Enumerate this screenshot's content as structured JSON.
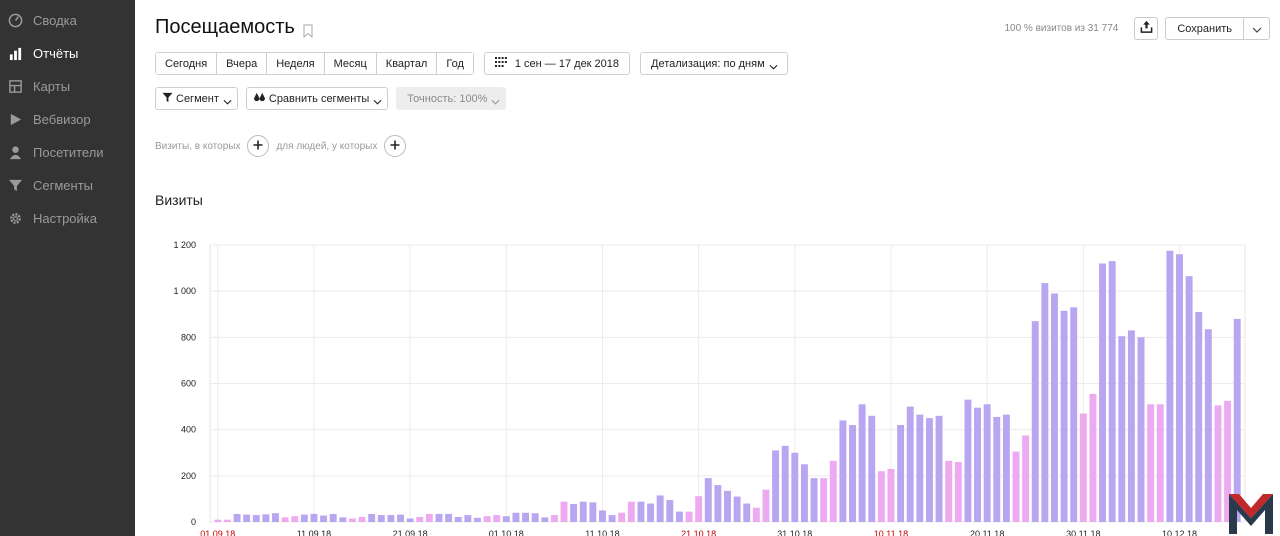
{
  "sidebar": {
    "items": [
      {
        "label": "Сводка",
        "icon": "dashboard-icon",
        "active": false
      },
      {
        "label": "Отчёты",
        "icon": "bar-chart-icon",
        "active": true
      },
      {
        "label": "Карты",
        "icon": "map-icon",
        "active": false
      },
      {
        "label": "Вебвизор",
        "icon": "play-icon",
        "active": false
      },
      {
        "label": "Посетители",
        "icon": "person-icon",
        "active": false
      },
      {
        "label": "Сегменты",
        "icon": "funnel-icon",
        "active": false
      },
      {
        "label": "Настройка",
        "icon": "gear-icon",
        "active": false
      }
    ]
  },
  "header": {
    "title": "Посещаемость",
    "visits_share": "100 % визитов из 31 774",
    "save_label": "Сохранить"
  },
  "periods": [
    "Сегодня",
    "Вчера",
    "Неделя",
    "Месяц",
    "Квартал",
    "Год"
  ],
  "date_range": "1 сен — 17 дек 2018",
  "detail": "Детализация: по дням",
  "segment_label": "Сегмент",
  "compare_label": "Сравнить сегменты",
  "accuracy_label": "Точность: 100%",
  "filter": {
    "visits_text": "Визиты, в которых",
    "people_text": "для людей, у которых"
  },
  "section_title": "Визиты",
  "colors": {
    "workday": "#b9a6f0",
    "weekend": "#eeaaf0",
    "sidebar": "#333333",
    "holiday_label": "#cc0000"
  },
  "chart_data": {
    "type": "bar",
    "ylim": [
      0,
      1200
    ],
    "yticks": [
      "1 200",
      "1 000",
      "800",
      "600",
      "400",
      "200",
      "0"
    ],
    "xticks": [
      {
        "label": "01.09.18",
        "holiday": true
      },
      {
        "label": "11.09.18",
        "holiday": false
      },
      {
        "label": "21.09.18",
        "holiday": false
      },
      {
        "label": "01.10.18",
        "holiday": false
      },
      {
        "label": "11.10.18",
        "holiday": false
      },
      {
        "label": "21.10.18",
        "holiday": true
      },
      {
        "label": "31.10.18",
        "holiday": false
      },
      {
        "label": "10.11.18",
        "holiday": true
      },
      {
        "label": "20.11.18",
        "holiday": false
      },
      {
        "label": "30.11.18",
        "holiday": false
      },
      {
        "label": "10.12.18",
        "holiday": false
      }
    ],
    "values": [
      10,
      10,
      35,
      32,
      30,
      33,
      38,
      20,
      25,
      32,
      35,
      28,
      35,
      20,
      15,
      22,
      35,
      30,
      30,
      32,
      15,
      22,
      35,
      35,
      35,
      22,
      30,
      18,
      25,
      30,
      25,
      40,
      40,
      38,
      20,
      30,
      88,
      78,
      88,
      85,
      50,
      30,
      40,
      88,
      88,
      80,
      115,
      95,
      45,
      45,
      112,
      190,
      160,
      135,
      110,
      80,
      62,
      140,
      310,
      330,
      300,
      250,
      190,
      190,
      265,
      440,
      420,
      510,
      460,
      220,
      230,
      420,
      500,
      465,
      450,
      460,
      265,
      260,
      530,
      495,
      510,
      455,
      465,
      305,
      375,
      870,
      1035,
      990,
      915,
      930,
      470,
      555,
      1120,
      1130,
      805,
      830,
      800,
      510,
      510,
      1175,
      1160,
      1065,
      910,
      835,
      505,
      525,
      880
    ],
    "weekend": [
      1,
      1,
      0,
      0,
      0,
      0,
      0,
      1,
      1,
      0,
      0,
      0,
      0,
      0,
      1,
      1,
      0,
      0,
      0,
      0,
      0,
      1,
      1,
      0,
      0,
      0,
      0,
      0,
      1,
      1,
      0,
      0,
      0,
      0,
      0,
      1,
      1,
      0,
      0,
      0,
      0,
      0,
      1,
      1,
      0,
      0,
      0,
      0,
      0,
      1,
      1,
      0,
      0,
      0,
      0,
      0,
      1,
      1,
      0,
      0,
      0,
      0,
      0,
      1,
      1,
      0,
      0,
      0,
      0,
      1,
      1,
      0,
      0,
      0,
      0,
      0,
      1,
      1,
      0,
      0,
      0,
      0,
      0,
      1,
      1,
      0,
      0,
      0,
      0,
      0,
      1,
      1,
      0,
      0,
      0,
      0,
      0,
      1,
      1,
      0,
      0,
      0,
      0,
      0,
      1,
      1,
      0
    ]
  }
}
